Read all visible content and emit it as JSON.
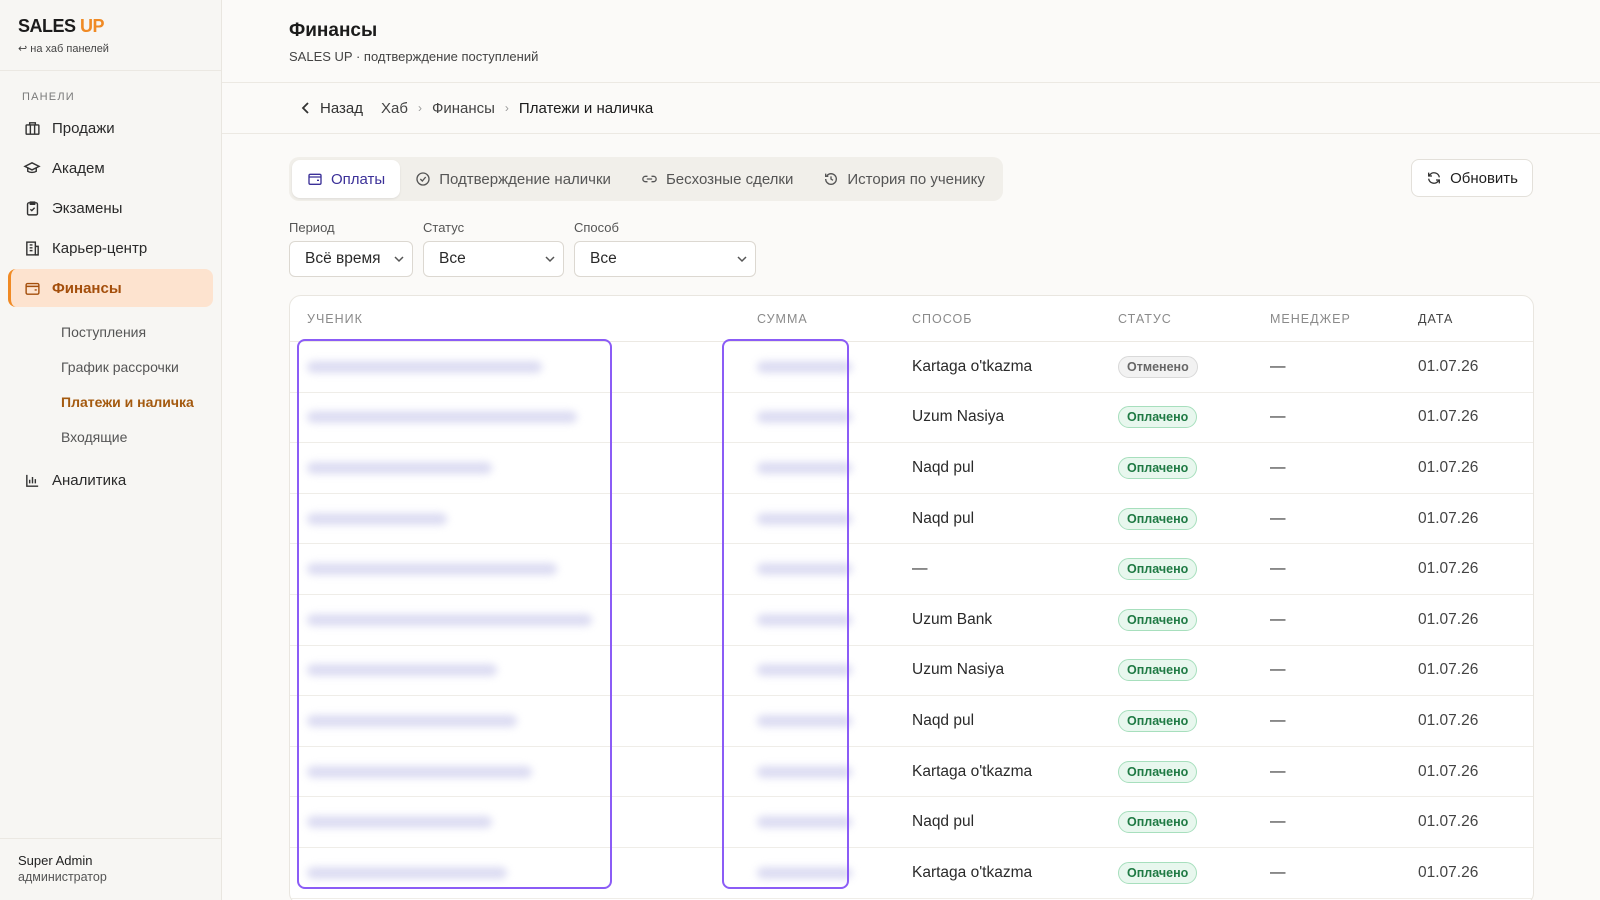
{
  "brand": {
    "logo_main": "SALES",
    "logo_accent": "UP",
    "hub_link": "↩ на хаб панелей"
  },
  "sidebar": {
    "section_title": "ПАНЕЛИ",
    "items": [
      {
        "label": "Продажи",
        "icon": "store-icon"
      },
      {
        "label": "Академ",
        "icon": "graduation-cap-icon"
      },
      {
        "label": "Экзамены",
        "icon": "clipboard-icon"
      },
      {
        "label": "Карьер-центр",
        "icon": "building-icon"
      },
      {
        "label": "Финансы",
        "icon": "wallet-icon"
      },
      {
        "label": "Аналитика",
        "icon": "bar-chart-icon"
      }
    ],
    "sub_items": [
      "Поступления",
      "График рассрочки",
      "Платежи и наличка",
      "Входящие"
    ]
  },
  "user": {
    "name": "Super Admin",
    "role": "администратор"
  },
  "header": {
    "title": "Финансы",
    "subtitle": "SALES UP · подтверждение поступлений"
  },
  "breadcrumb": {
    "back": "Назад",
    "items": [
      "Хаб",
      "Финансы",
      "Платежи и наличка"
    ]
  },
  "tabs": [
    "Оплаты",
    "Подтверждение налички",
    "Бесхозные сделки",
    "История по ученику"
  ],
  "refresh_label": "Обновить",
  "filters": [
    {
      "label": "Период",
      "value": "Всё время"
    },
    {
      "label": "Статус",
      "value": "Все"
    },
    {
      "label": "Способ",
      "value": "Все"
    }
  ],
  "table": {
    "columns": [
      "УЧЕНИК",
      "СУММА",
      "СПОСОБ",
      "СТАТУС",
      "МЕНЕДЖЕР",
      "ДАТА"
    ],
    "rows": [
      {
        "method": "Kartaga o'tkazma",
        "status": "Отменено",
        "manager": "—",
        "date": "01.07.26"
      },
      {
        "method": "Uzum Nasiya",
        "status": "Оплачено",
        "manager": "—",
        "date": "01.07.26"
      },
      {
        "method": "Naqd pul",
        "status": "Оплачено",
        "manager": "—",
        "date": "01.07.26"
      },
      {
        "method": "Naqd pul",
        "status": "Оплачено",
        "manager": "—",
        "date": "01.07.26"
      },
      {
        "method": "—",
        "status": "Оплачено",
        "manager": "—",
        "date": "01.07.26"
      },
      {
        "method": "Uzum Bank",
        "status": "Оплачено",
        "manager": "—",
        "date": "01.07.26"
      },
      {
        "method": "Uzum Nasiya",
        "status": "Оплачено",
        "manager": "—",
        "date": "01.07.26"
      },
      {
        "method": "Naqd pul",
        "status": "Оплачено",
        "manager": "—",
        "date": "01.07.26"
      },
      {
        "method": "Kartaga o'tkazma",
        "status": "Оплачено",
        "manager": "—",
        "date": "01.07.26"
      },
      {
        "method": "Naqd pul",
        "status": "Оплачено",
        "manager": "—",
        "date": "01.07.26"
      },
      {
        "method": "Kartaga o'tkazma",
        "status": "Оплачено",
        "manager": "—",
        "date": "01.07.26"
      }
    ]
  },
  "colors": {
    "accent": "#f08a24",
    "tab_active": "#3b3098",
    "highlight": "#8b5cf6",
    "paid": "#1f7a44"
  }
}
